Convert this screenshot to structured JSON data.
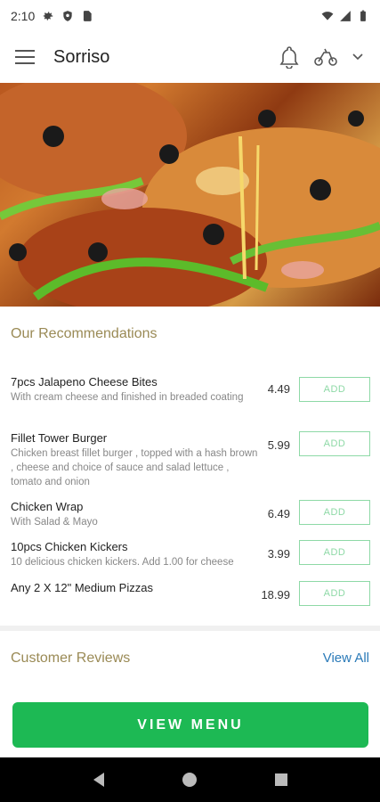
{
  "status_bar": {
    "time": "2:10"
  },
  "app_bar": {
    "title": "Sorriso"
  },
  "recommendations": {
    "title": "Our Recommendations",
    "items": [
      {
        "name": "7pcs Jalapeno Cheese Bites",
        "description": "With cream cheese and finished in breaded coating",
        "price": "4.49",
        "add_label": "ADD"
      },
      {
        "name": "Fillet Tower Burger",
        "description": "Chicken breast fillet burger , topped with a hash brown , cheese and choice of sauce and salad lettuce , tomato and onion",
        "price": "5.99",
        "add_label": "ADD"
      },
      {
        "name": "Chicken Wrap",
        "description": "With Salad & Mayo",
        "price": "6.49",
        "add_label": "ADD"
      },
      {
        "name": "10pcs Chicken Kickers",
        "description": "10 delicious chicken kickers. Add 1.00 for cheese",
        "price": "3.99",
        "add_label": "ADD"
      },
      {
        "name": "Any 2 X 12\"  Medium Pizzas",
        "description": "",
        "price": "18.99",
        "add_label": "ADD"
      }
    ]
  },
  "reviews": {
    "title": "Customer Reviews",
    "view_all": "View All"
  },
  "cta": {
    "label": "VIEW MENU"
  },
  "colors": {
    "accent": "#1db954",
    "add_border": "#8ed9a6",
    "section_title": "#9a8a55",
    "link": "#2a7ab8"
  }
}
